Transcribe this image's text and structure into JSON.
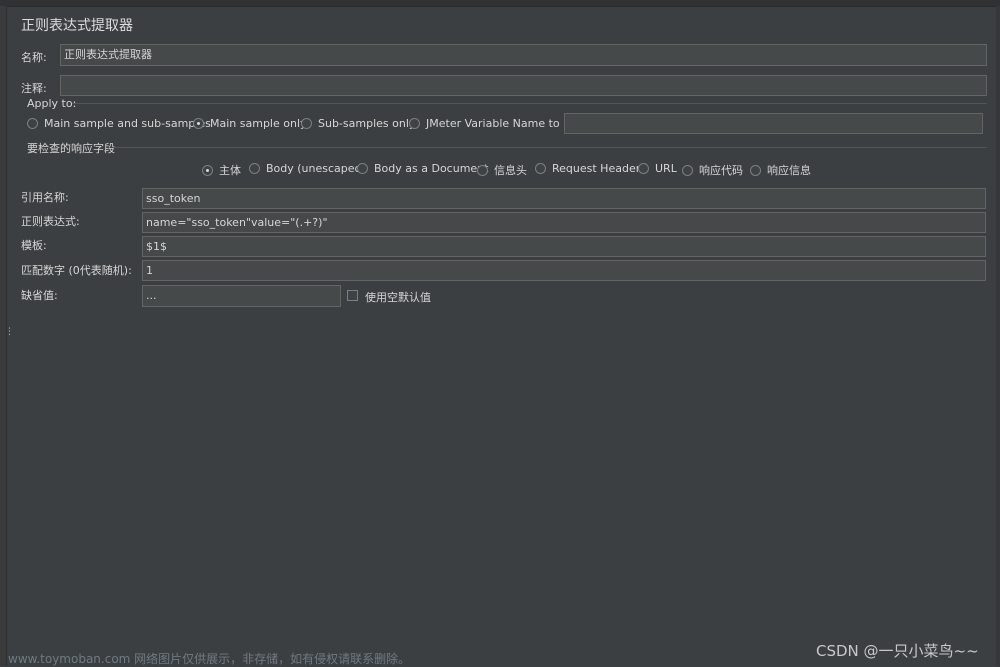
{
  "title": "正则表达式提取器",
  "name_label": "名称:",
  "name_value": "正则表达式提取器",
  "comment_label": "注释:",
  "comment_value": "",
  "apply_to": {
    "label": "Apply to:",
    "options": [
      "Main sample and sub-samples",
      "Main sample only",
      "Sub-samples only",
      "JMeter Variable Name to use"
    ],
    "selected": "Main sample only",
    "variable_value": ""
  },
  "field_check": {
    "label": "要检查的响应字段",
    "options": [
      "主体",
      "Body (unescaped)",
      "Body as a Document",
      "信息头",
      "Request Headers",
      "URL",
      "响应代码",
      "响应信息"
    ],
    "selected": "主体"
  },
  "ref_name": {
    "label": "引用名称:",
    "value": "sso_token"
  },
  "regex": {
    "label": "正则表达式:",
    "value": "name=\"sso_token\"value=\"(.+?)\""
  },
  "template": {
    "label": "模板:",
    "value": "$1$"
  },
  "match_no": {
    "label": "匹配数字 (0代表随机):",
    "value": "1"
  },
  "default_value": {
    "label": "缺省值:",
    "value": "...",
    "checkbox_label": "使用空默认值",
    "checked": false
  },
  "watermark": {
    "left": "www.toymoban.com 网络图片仅供展示，非存储，如有侵权请联系删除。",
    "right": "CSDN @一只小菜鸟~~"
  }
}
